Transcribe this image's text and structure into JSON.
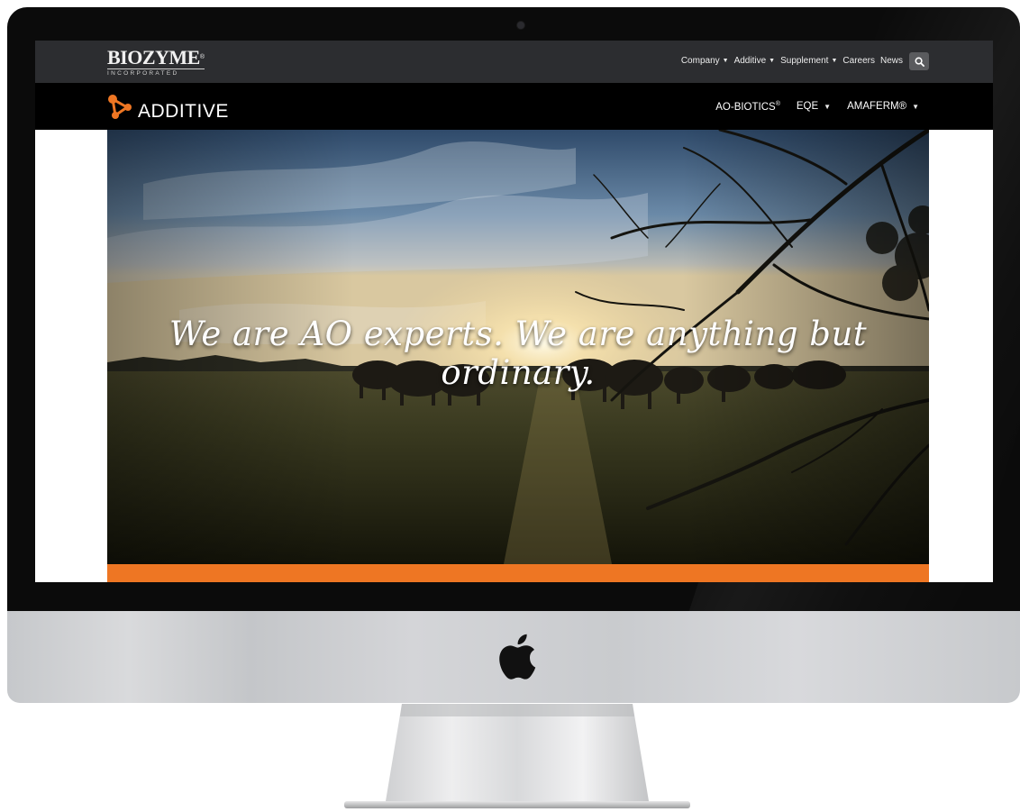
{
  "header": {
    "brand": "BIOZYME",
    "brand_mark": "®",
    "brand_sub": "INCORPORATED",
    "nav": [
      {
        "label": "Company",
        "dropdown": true
      },
      {
        "label": "Additive",
        "dropdown": true
      },
      {
        "label": "Supplement",
        "dropdown": true
      },
      {
        "label": "Careers",
        "dropdown": false
      },
      {
        "label": "News",
        "dropdown": false
      }
    ],
    "search_icon": "search-icon"
  },
  "subheader": {
    "product": "ADDITIVE",
    "nav": [
      {
        "label": "AO-BIOTICS",
        "mark": "®",
        "dropdown": false
      },
      {
        "label": "EQE",
        "mark": "",
        "dropdown": true
      },
      {
        "label": "AMAFERM®",
        "mark": "",
        "dropdown": true
      }
    ]
  },
  "hero": {
    "headline": "We are AO experts. We are anything but ordinary."
  },
  "colors": {
    "accent_orange": "#ee7623",
    "topbar": "#2c2d30",
    "subbar": "#000000"
  },
  "device": {
    "icon": "apple-logo-icon"
  }
}
